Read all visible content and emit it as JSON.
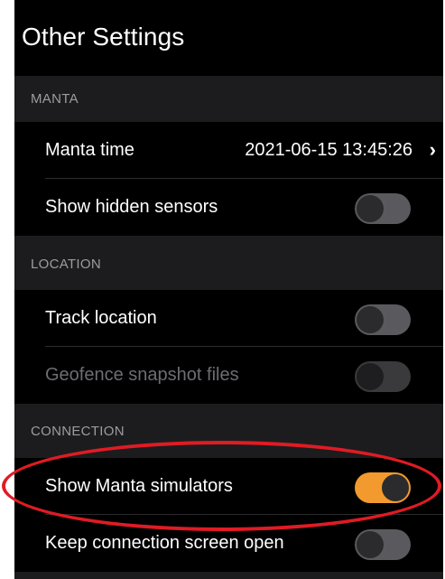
{
  "title": "Other Settings",
  "sections": {
    "manta": {
      "header": "MANTA",
      "time_label": "Manta time",
      "time_value": "2021-06-15 13:45:26",
      "hidden_sensors_label": "Show hidden sensors",
      "hidden_sensors_on": false
    },
    "location": {
      "header": "LOCATION",
      "track_label": "Track location",
      "track_on": false,
      "geofence_label": "Geofence snapshot files",
      "geofence_on": false,
      "geofence_enabled": false
    },
    "connection": {
      "header": "CONNECTION",
      "simulators_label": "Show Manta simulators",
      "simulators_on": true,
      "keep_open_label": "Keep connection screen open",
      "keep_open_on": false
    }
  },
  "icons": {
    "disclosure": "chevron-right-icon"
  },
  "colors": {
    "accent_toggle_on": "#f29a2e",
    "highlight_annotation": "#e01b24"
  }
}
